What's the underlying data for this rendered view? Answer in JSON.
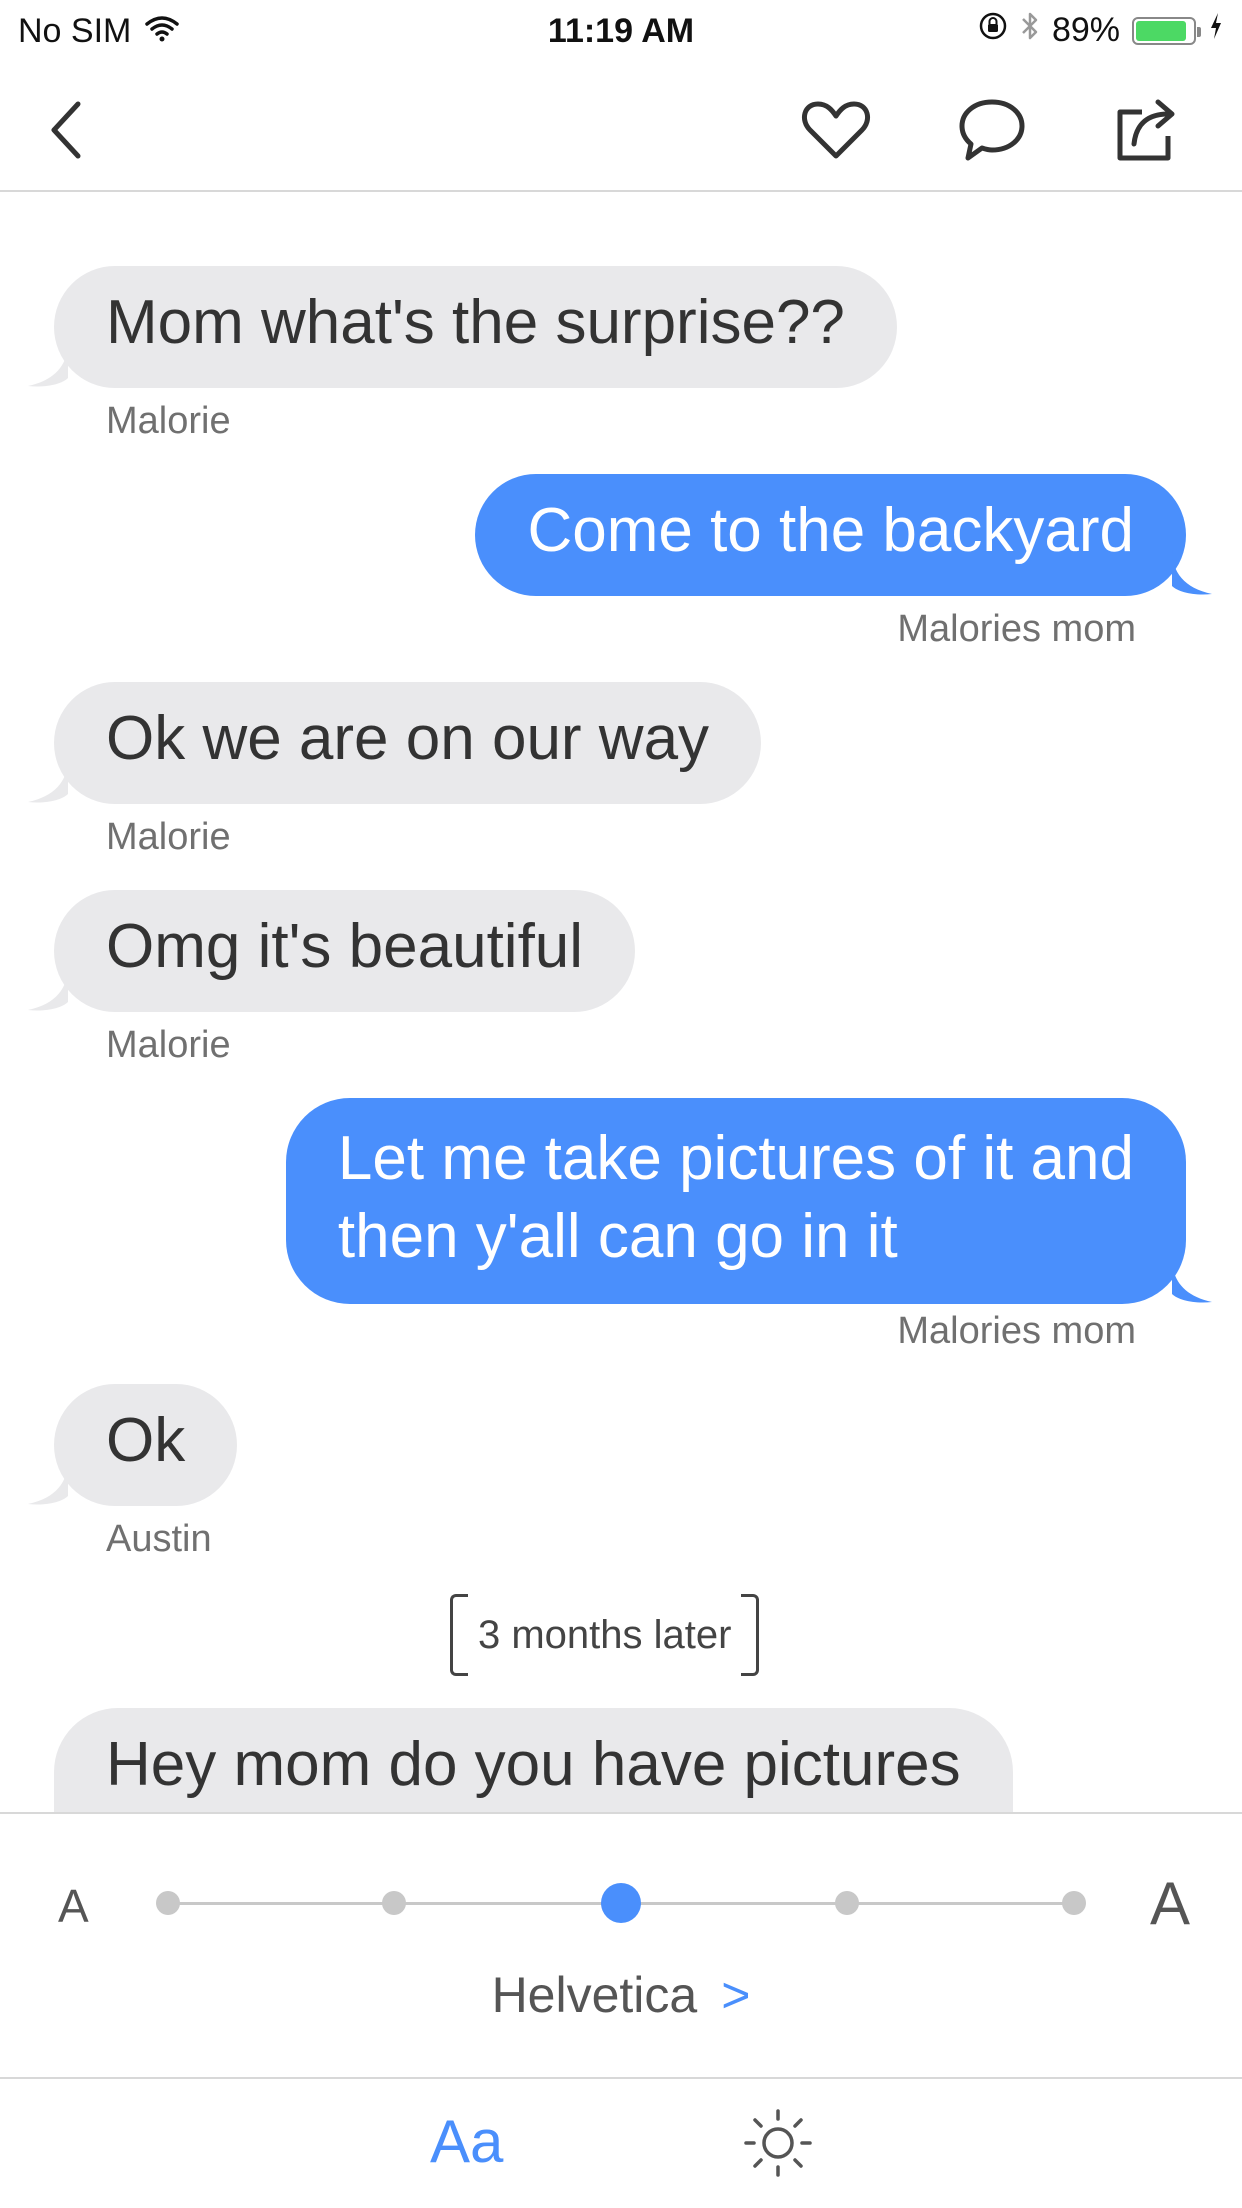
{
  "status_bar": {
    "carrier": "No SIM",
    "time": "11:19 AM",
    "battery_percent": "89%",
    "battery_level": 0.89,
    "battery_color": "#4cd964"
  },
  "nav": {
    "back_icon": "chevron-left-icon",
    "like_icon": "heart-icon",
    "comment_icon": "speech-bubble-icon",
    "share_icon": "share-icon"
  },
  "messages": [
    {
      "side": "left",
      "text": "Mom what's the surprise??",
      "sender": "Malorie"
    },
    {
      "side": "right",
      "text": "Come to the backyard",
      "sender": "Malories mom"
    },
    {
      "side": "left",
      "text": "Ok we are on our way",
      "sender": "Malorie"
    },
    {
      "side": "left",
      "text": "Omg it's beautiful",
      "sender": "Malorie"
    },
    {
      "side": "right",
      "text_lines": [
        "Let me take pictures of it and",
        "then y'all can go in it"
      ],
      "sender": "Malories mom"
    },
    {
      "side": "left",
      "text": "Ok",
      "sender": "Austin"
    },
    {
      "side": "left",
      "text": "Hey mom do you have pictures",
      "sender": ""
    }
  ],
  "time_divider": "3 months later",
  "font_panel": {
    "small_a": "A",
    "large_a": "A",
    "size_steps": 5,
    "selected_step": 3,
    "font_name": "Helvetica",
    "font_chevron": ">"
  },
  "toolbar": {
    "text_settings_label": "Aa",
    "brightness_icon": "sun-icon"
  },
  "colors": {
    "accent": "#4a8ffc",
    "incoming_bubble": "#e9e9eb",
    "outgoing_bubble": "#4a8ffc"
  }
}
